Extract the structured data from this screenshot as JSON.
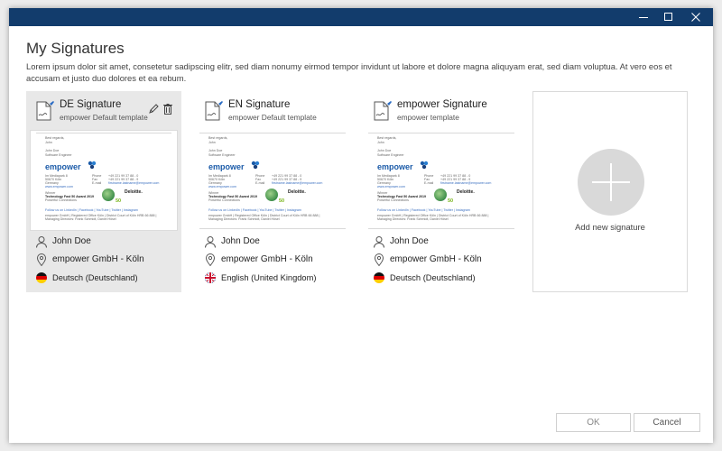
{
  "window": {
    "controls": {
      "minimize_icon": "minimize-icon",
      "maximize_icon": "maximize-icon",
      "close_icon": "close-icon"
    },
    "title_bar_color": "#123c6c"
  },
  "page": {
    "title": "My Signatures",
    "description": "Lorem ipsum dolor sit amet, consetetur sadipscing elitr, sed diam nonumy eirmod tempor invidunt ut labore et dolore magna aliquyam erat, sed diam voluptua. At vero eos et accusam et justo duo dolores et ea rebum."
  },
  "preview": {
    "greeting": "Best regards,",
    "short_name": "John",
    "full_name": "John Doe",
    "role": "Software Engineer",
    "logo_text": "empower",
    "address": [
      "Im Mediapark 8",
      "50670 Köln",
      "Germany",
      "www.empower.com"
    ],
    "contact_labels": [
      "Phone",
      "Fax",
      "E-mail"
    ],
    "contact_values": [
      "+49 221 99 37 88 - 0",
      "+49 221 99 37 88 - 9",
      "firstname.lastname@empower.com"
    ],
    "award_title": "Winner",
    "award_text": "Technology Fast 50 Award 2019",
    "award_sub": "Powerful Connections",
    "deloitte": "Deloitte.",
    "fifty": "50",
    "follow": "Follow us on LinkedIn | Facebook | YouTube | Twitter | Instagram",
    "legal": "empower GmbH | Registered Office Köln | District Court of Köln HRB 66 888 | Managing Directors: Frank Schmidt, Daniel Hösel"
  },
  "cards": [
    {
      "name": "DE Signature",
      "template": "empower Default template",
      "user": "John Doe",
      "location": "empower GmbH - Köln",
      "language": "Deutsch (Deutschland)",
      "flag": "german-flag-icon",
      "selected": true
    },
    {
      "name": "EN Signature",
      "template": "empower Default template",
      "user": "John Doe",
      "location": "empower GmbH - Köln",
      "language": "English (United Kingdom)",
      "flag": "uk-flag-icon",
      "selected": false
    },
    {
      "name": "empower Signature",
      "template": "empower template",
      "user": "John Doe",
      "location": "empower GmbH - Köln",
      "language": "Deutsch (Deutschland)",
      "flag": "german-flag-icon",
      "selected": false
    }
  ],
  "add_card": {
    "label": "Add new signature"
  },
  "buttons": {
    "ok": "OK",
    "cancel": "Cancel"
  }
}
